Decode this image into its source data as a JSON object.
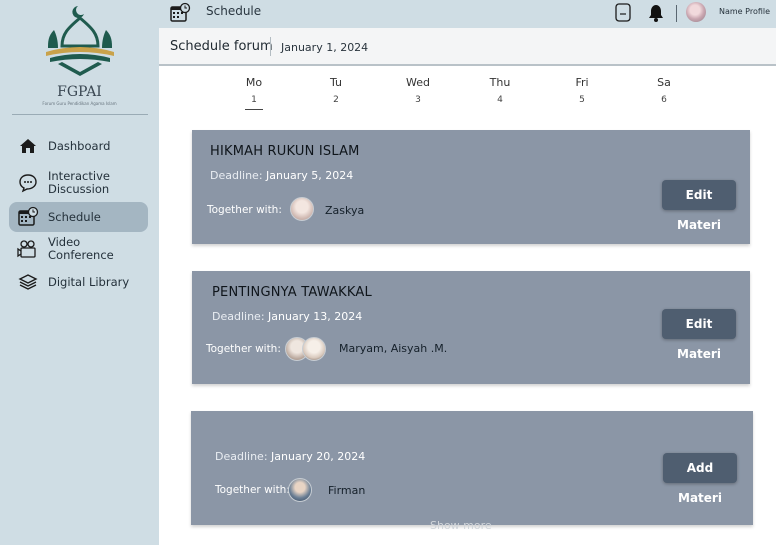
{
  "brand": {
    "name": "FGPAI",
    "tagline": "Forum Guru Pendidikan Agama Islam"
  },
  "sidebar": {
    "items": [
      {
        "label": "Dashboard",
        "icon": "home-icon"
      },
      {
        "label": "Interactive Discussion",
        "icon": "chat-icon"
      },
      {
        "label": "Schedule",
        "icon": "calendar-clock-icon",
        "active": true
      },
      {
        "label": "Video Conference",
        "icon": "video-camera-icon"
      },
      {
        "label": "Digital Library",
        "icon": "books-icon"
      }
    ]
  },
  "topbar": {
    "title": "Schedule",
    "profile_name": "Name Profile"
  },
  "subheader": {
    "title": "Schedule forum",
    "date": "January 1, 2024"
  },
  "week": [
    {
      "name": "Mo",
      "date": "1",
      "active": true
    },
    {
      "name": "Tu",
      "date": "2"
    },
    {
      "name": "Wed",
      "date": "3"
    },
    {
      "name": "Thu",
      "date": "4"
    },
    {
      "name": "Fri",
      "date": "5"
    },
    {
      "name": "Sa",
      "date": "6"
    }
  ],
  "cards": [
    {
      "title": "HIKMAH RUKUN ISLAM",
      "deadline_label": "Deadline:",
      "deadline": "January 5, 2024",
      "together_label": "Together with:",
      "names": "Zaskya",
      "button": "Edit Materi"
    },
    {
      "title": "PENTINGNYA TAWAKKAL",
      "deadline_label": "Deadline:",
      "deadline": "January 13, 2024",
      "together_label": "Together with:",
      "names": "Maryam, Aisyah .M.",
      "button": "Edit Materi"
    },
    {
      "title": "",
      "deadline_label": "Deadline:",
      "deadline": "January 20, 2024",
      "together_label": "Together with:",
      "names": "Firman",
      "button": "Add Materi"
    }
  ],
  "show_more": "Show more",
  "colors": {
    "sidebar_bg": "#cfdde4",
    "card_bg": "#8b96a6",
    "button_bg": "#4f5e70",
    "logo_green": "#1f5b4e"
  }
}
